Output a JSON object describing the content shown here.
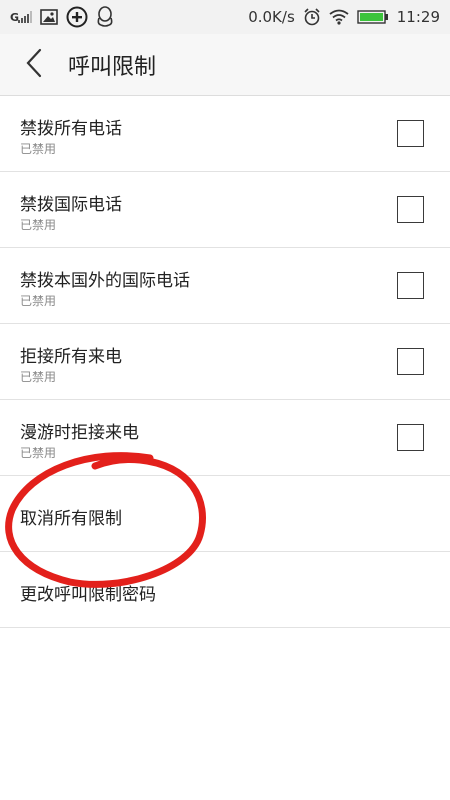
{
  "status_bar": {
    "signal": "G",
    "network_speed": "0.0K/s",
    "time": "11:29",
    "icons": [
      "signal-icon",
      "image-icon",
      "plus-circle-icon",
      "qq-icon",
      "alarm-icon",
      "wifi-icon",
      "battery-icon"
    ]
  },
  "header": {
    "title": "呼叫限制"
  },
  "items": [
    {
      "label": "禁拨所有电话",
      "status": "已禁用",
      "checked": false
    },
    {
      "label": "禁拨国际电话",
      "status": "已禁用",
      "checked": false
    },
    {
      "label": "禁拨本国外的国际电话",
      "status": "已禁用",
      "checked": false
    },
    {
      "label": "拒接所有来电",
      "status": "已禁用",
      "checked": false
    },
    {
      "label": "漫游时拒接来电",
      "status": "已禁用",
      "checked": false
    }
  ],
  "actions": [
    {
      "label": "取消所有限制"
    },
    {
      "label": "更改呼叫限制密码"
    }
  ],
  "colors": {
    "annotation": "#e3201b",
    "text": "#222222",
    "subtext": "#8a8a8a",
    "battery": "#3cc43c"
  }
}
